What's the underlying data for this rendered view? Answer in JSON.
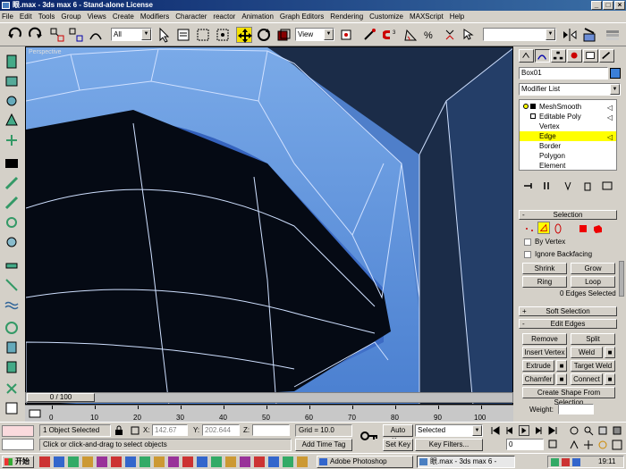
{
  "window": {
    "title": "眼.max - 3ds max 6 - Stand-alone License",
    "minimize": "_",
    "maximize": "□",
    "close": "×"
  },
  "menu": [
    "File",
    "Edit",
    "Tools",
    "Group",
    "Views",
    "Create",
    "Modifiers",
    "Character",
    "reactor",
    "Animation",
    "Graph Editors",
    "Rendering",
    "Customize",
    "MAXScript",
    "Help"
  ],
  "toolbar": {
    "filter_value": "All",
    "refcoord_value": "View"
  },
  "viewport": {
    "label": "Perspective"
  },
  "panel": {
    "object_name": "Box01",
    "object_color": "#3a7fd8",
    "modifier_list": "Modifier List",
    "stack": [
      "MeshSmooth",
      "Editable Poly",
      "Vertex",
      "Edge",
      "Border",
      "Polygon",
      "Element"
    ],
    "stack_selected": "Edge",
    "selection": {
      "title": "Selection",
      "by_vertex": "By Vertex",
      "ignore_backfacing": "Ignore Backfacing",
      "shrink": "Shrink",
      "grow": "Grow",
      "ring": "Ring",
      "loop": "Loop",
      "status": "0 Edges Selected"
    },
    "soft_selection": "Soft Selection",
    "edit_edges": {
      "title": "Edit Edges",
      "remove": "Remove",
      "split": "Split",
      "insert_vertex": "Insert Vertex",
      "weld": "Weld",
      "extrude": "Extrude",
      "target_weld": "Target Weld",
      "chamfer": "Chamfer",
      "connect": "Connect",
      "create_shape": "Create Shape From Selection",
      "weight": "Weight:"
    },
    "rollout_minus": "-",
    "rollout_plus": "+"
  },
  "timeline": {
    "frame": "0 / 100",
    "ticks": [
      "0",
      "10",
      "20",
      "30",
      "40",
      "50",
      "60",
      "70",
      "80",
      "90",
      "100"
    ]
  },
  "status": {
    "selected": "1 Object Selected",
    "prompt": "Click or click-and-drag to select objects",
    "x_label": "X:",
    "x": "142.67",
    "y_label": "Y:",
    "y": "202.644",
    "z_label": "Z:",
    "grid": "Grid = 10.0",
    "add_time_tag": "Add Time Tag",
    "auto_key": "Auto Key",
    "selected_mode": "Selected",
    "set_key": "Set Key",
    "key_filters": "Key Filters...",
    "frame_field": "0"
  },
  "taskbar": {
    "start": "开始",
    "photoshop": "Adobe Photoshop",
    "max_task": "眼.max - 3ds max 6 - Sta...",
    "clock": "19:11"
  },
  "colors": {
    "highlight": "#ffff00",
    "viewport_blue": "#5a8ad0"
  }
}
